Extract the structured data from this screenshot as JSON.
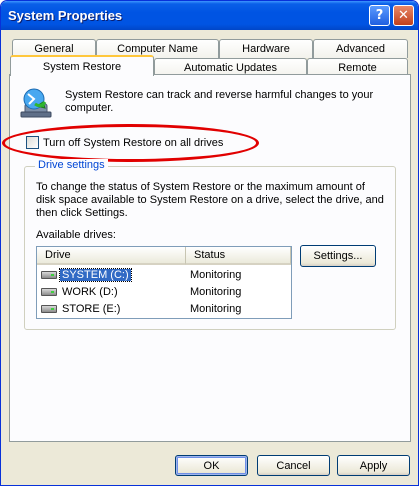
{
  "window": {
    "title": "System Properties",
    "help_label": "?",
    "close_label": "✕"
  },
  "tabs": {
    "row1": [
      "General",
      "Computer Name",
      "Hardware",
      "Advanced"
    ],
    "row2": [
      "System Restore",
      "Automatic Updates",
      "Remote"
    ],
    "active": "System Restore"
  },
  "system_restore": {
    "description": "System Restore can track and reverse harmful changes to your computer.",
    "turn_off_label": "Turn off System Restore on all drives",
    "turn_off_checked": false
  },
  "drive_settings": {
    "legend": "Drive settings",
    "description": "To change the status of System Restore or the maximum amount of disk space available to System Restore on a drive, select the drive, and then click Settings.",
    "available_label": "Available drives:",
    "columns": [
      "Drive",
      "Status"
    ],
    "drives": [
      {
        "name": "SYSTEM (C:)",
        "status": "Monitoring"
      },
      {
        "name": "WORK (D:)",
        "status": "Monitoring"
      },
      {
        "name": "STORE (E:)",
        "status": "Monitoring"
      }
    ],
    "settings_button": "Settings..."
  },
  "footer": {
    "ok": "OK",
    "cancel": "Cancel",
    "apply": "Apply"
  }
}
